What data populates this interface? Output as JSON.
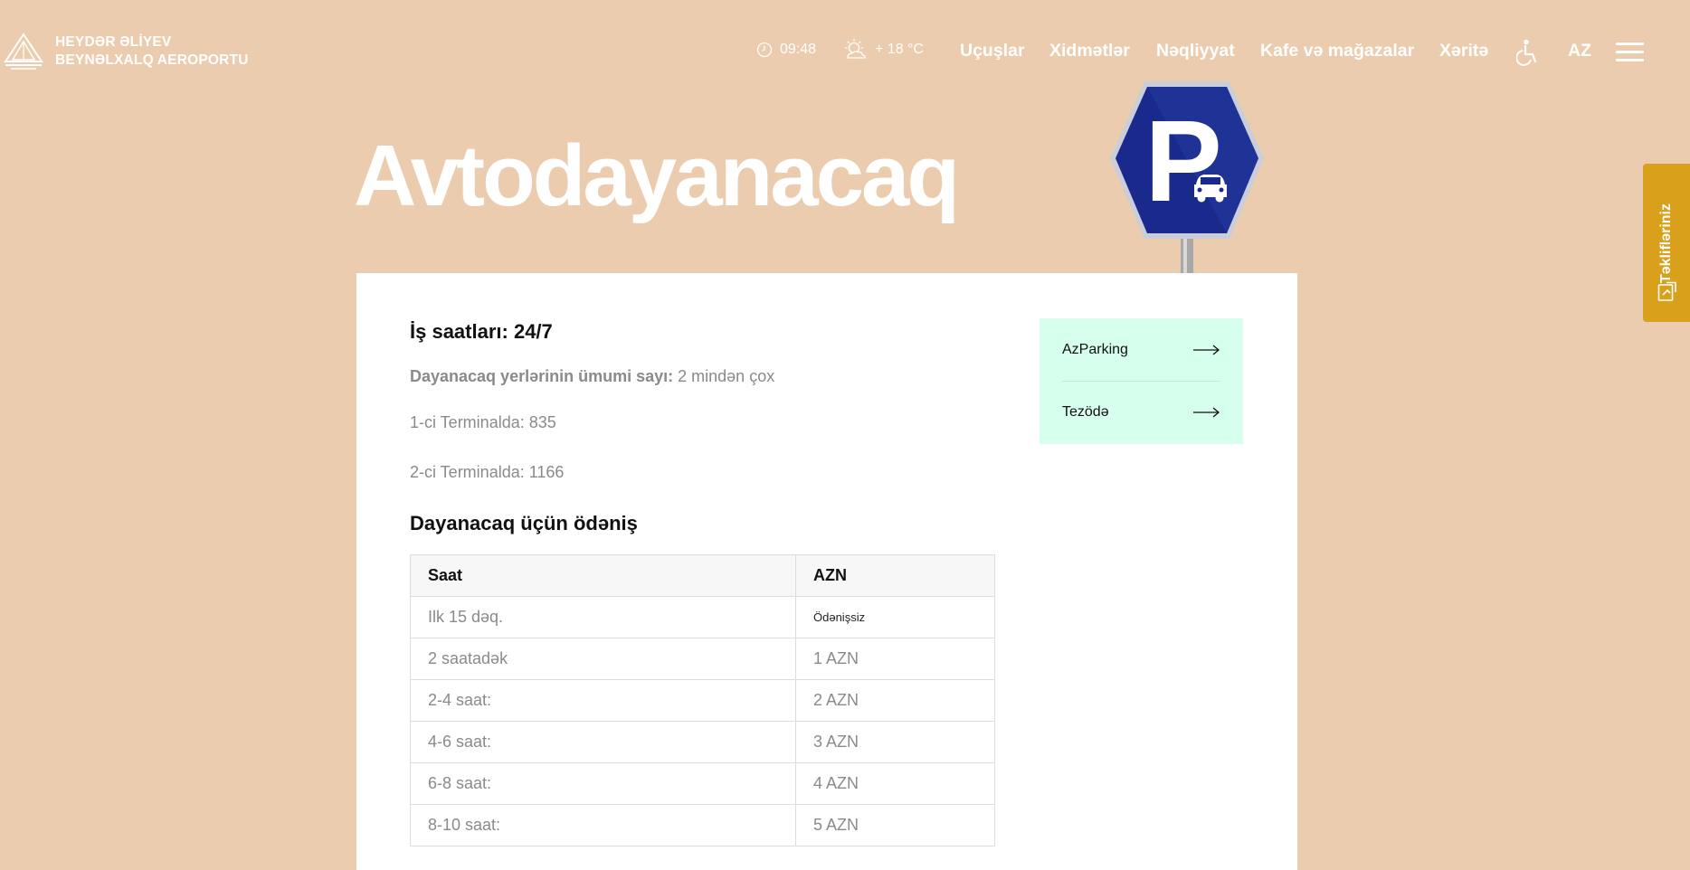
{
  "header": {
    "logo_line1": "HEYDƏR ƏLİYEV",
    "logo_line2": "BEYNƏLXALQ AEROPORTU",
    "time": "09:48",
    "weather": "+ 18 °C",
    "nav": [
      "Uçuşlar",
      "Xidmətlər",
      "Nəqliyyat",
      "Kafe və mağazalar",
      "Xəritə"
    ],
    "lang": "AZ"
  },
  "hero": {
    "title": "Avtodayanacaq",
    "sign_letter": "P"
  },
  "side_tab": {
    "label": "Təklifləriniz"
  },
  "content": {
    "hours": "İş saatları: 24/7",
    "total_label": "Dayanacaq yerlərinin ümumi sayı:",
    "total_value": "2 mindən çox",
    "terminal1": "1-ci Terminalda: 835",
    "terminal2": "2-ci Terminalda: 1166",
    "payment_heading": "Dayanacaq üçün ödəniş",
    "table": {
      "headers": [
        "Saat",
        "AZN"
      ],
      "rows": [
        [
          "Ilk 15 dəq.",
          "Ödənişsiz"
        ],
        [
          "2 saatadək",
          "1 AZN"
        ],
        [
          "2-4 saat:",
          "2 AZN"
        ],
        [
          "4-6 saat:",
          "3 AZN"
        ],
        [
          "6-8 saat:",
          "4 AZN"
        ],
        [
          "8-10 saat:",
          "5 AZN"
        ]
      ]
    }
  },
  "links": [
    {
      "label": "AzParking"
    },
    {
      "label": "Tezödə"
    }
  ],
  "colors": {
    "background": "#ecccae",
    "card": "#ffffff",
    "link_panel": "#d6ffed",
    "side_tab": "#d9a01c",
    "sign_blue": "#1a2a8c"
  }
}
